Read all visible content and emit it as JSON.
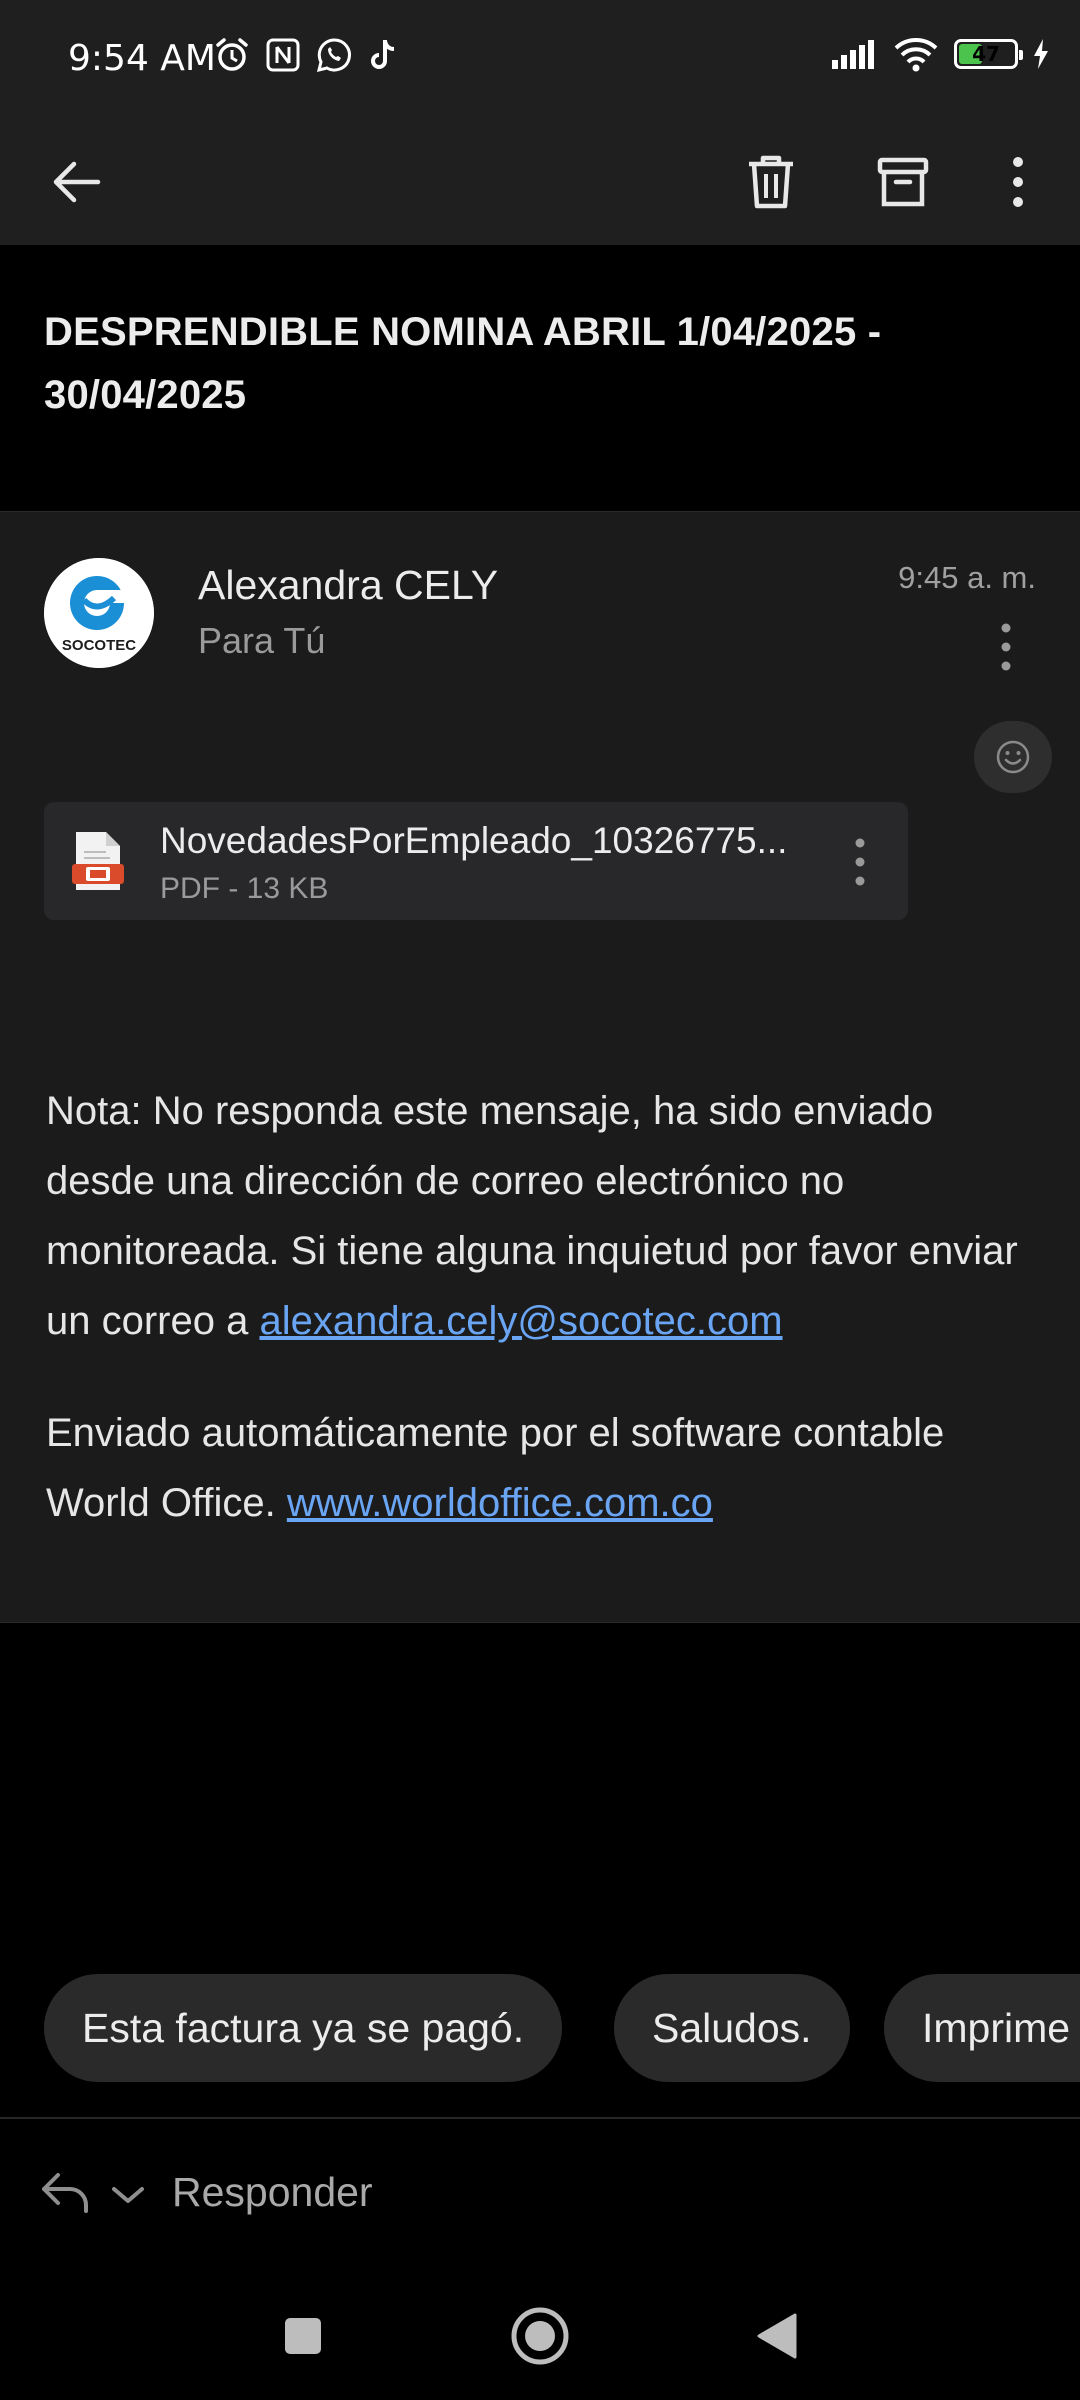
{
  "status_bar": {
    "time": "9:54 AM",
    "left_icons": [
      "alarm-icon",
      "nfc-icon",
      "whatsapp-icon",
      "tiktok-icon"
    ],
    "right_icons": [
      "signal-icon",
      "wifi-icon",
      "battery-icon",
      "charging-icon"
    ],
    "battery_level": "47",
    "battery_fraction": 0.47
  },
  "toolbar": {
    "back_icon": "arrow-left-icon",
    "actions": [
      "trash-icon",
      "archive-icon",
      "more-vertical-icon"
    ]
  },
  "email": {
    "subject": "DESPRENDIBLE NOMINA ABRIL 1/04/2025  - 30/04/2025",
    "sender": "Alexandra CELY",
    "recipient": "Para Tú",
    "time": "9:45 a. m.",
    "avatar_text": "SOCOTEC",
    "attachment": {
      "name": "NovedadesPorEmpleado_10326775...",
      "meta": "PDF - 13 KB"
    },
    "body": {
      "paragraph1_text": "Nota: No responda este mensaje, ha sido enviado desde una dirección de correo electrónico no monitoreada. Si tiene alguna inquietud por favor enviar un correo a ",
      "paragraph1_link": "alexandra.cely@socotec.com",
      "paragraph2_text": "Enviado automáticamente por el software contable World Office. ",
      "paragraph2_link": "www.worldoffice.com.co"
    }
  },
  "smart_replies": [
    "Esta factura ya se pagó.",
    "Saludos.",
    "Imprime"
  ],
  "reply_bar": {
    "label": "Responder"
  },
  "colors": {
    "accent_link": "#6aa5f4",
    "brand_blue": "#1a8fd6",
    "battery_green": "#4cc34c"
  }
}
